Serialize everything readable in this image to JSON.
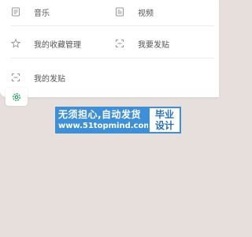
{
  "menu": {
    "items": [
      {
        "label": "音乐",
        "icon": "music-icon"
      },
      {
        "label": "视频",
        "icon": "video-icon"
      },
      {
        "label": "我的收藏管理",
        "icon": "star-icon"
      },
      {
        "label": "我要发贴",
        "icon": "compose-icon"
      },
      {
        "label": "我的发贴",
        "icon": "my-posts-icon"
      }
    ]
  },
  "settings": {
    "icon": "gear-icon",
    "color": "#2e9d6e"
  },
  "promo": {
    "line1": "无须担心,自动发货",
    "line2": "www.51topmind.com",
    "badge_line1": "毕业",
    "badge_line2": "设计",
    "bg_color": "#3d8fd8"
  }
}
